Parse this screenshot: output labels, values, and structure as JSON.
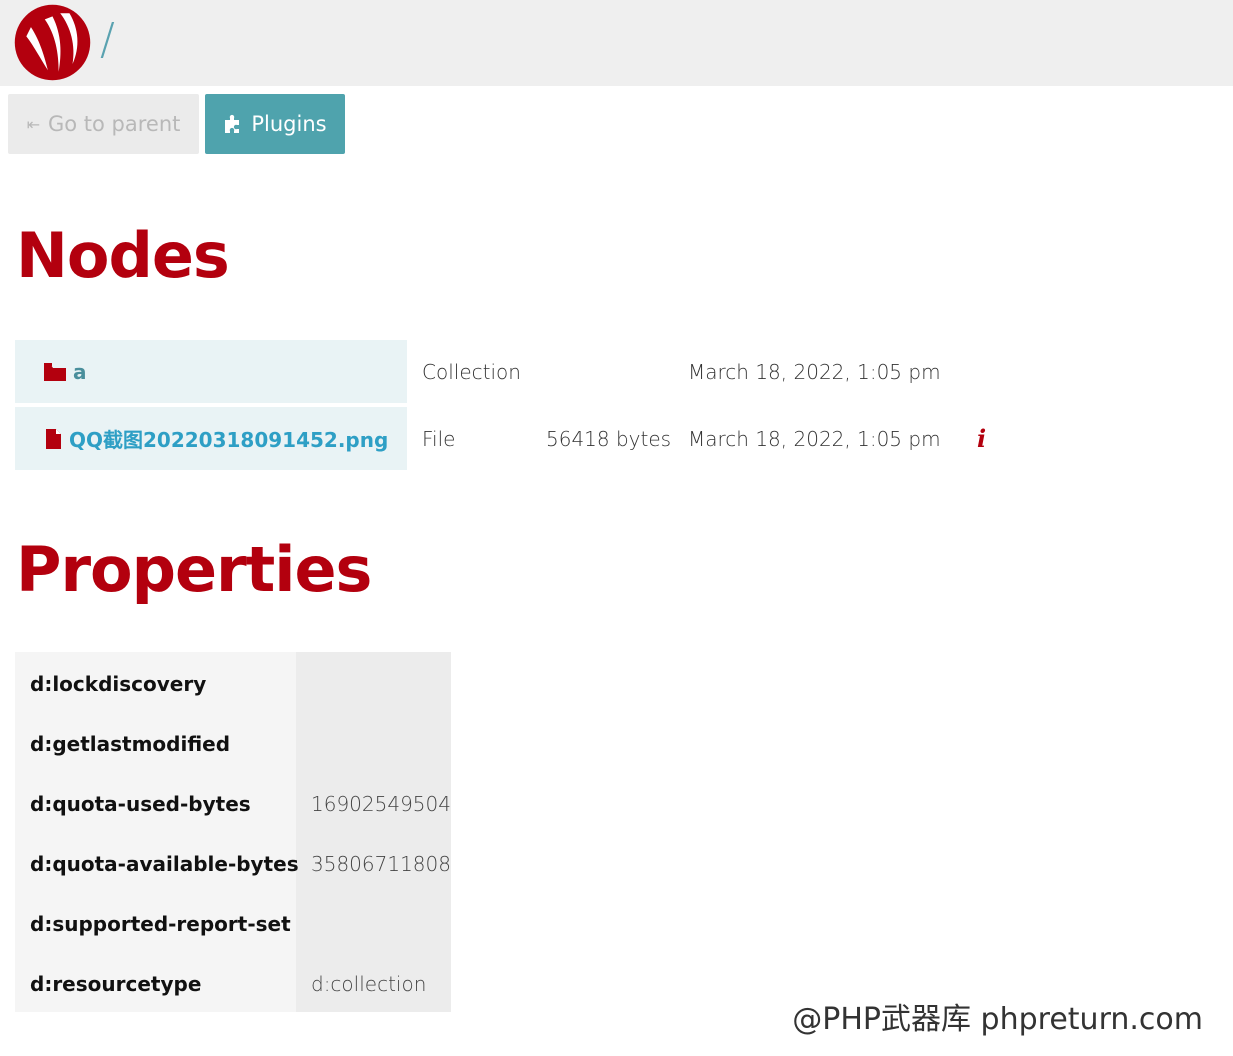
{
  "header": {
    "breadcrumb": "/"
  },
  "toolbar": {
    "parent_label": "Go to parent",
    "parent_arrow": "⇤",
    "plugins_label": "Plugins"
  },
  "nodes": {
    "title": "Nodes",
    "rows": [
      {
        "icon": "folder-icon",
        "name": "a",
        "type": "Collection",
        "size": "",
        "date": "March 18, 2022, 1:05 pm",
        "info": ""
      },
      {
        "icon": "file-icon",
        "name": "QQ截图20220318091452.png",
        "type": "File",
        "size": "56418 bytes",
        "date": "March 18, 2022, 1:05 pm",
        "info": "i"
      }
    ]
  },
  "properties": {
    "title": "Properties",
    "rows": [
      {
        "key": "d:lockdiscovery",
        "value": ""
      },
      {
        "key": "d:getlastmodified",
        "value": ""
      },
      {
        "key": "d:quota-used-bytes",
        "value": "16902549504"
      },
      {
        "key": "d:quota-available-bytes",
        "value": "35806711808"
      },
      {
        "key": "d:supported-report-set",
        "value": ""
      },
      {
        "key": "d:resourcetype",
        "value": "d:collection"
      }
    ]
  },
  "watermark": "@PHP武器库 phpreturn.com",
  "colors": {
    "accent": "#b3000e",
    "plugins_button": "#4fa3ad",
    "link": "#2e9fc5"
  }
}
